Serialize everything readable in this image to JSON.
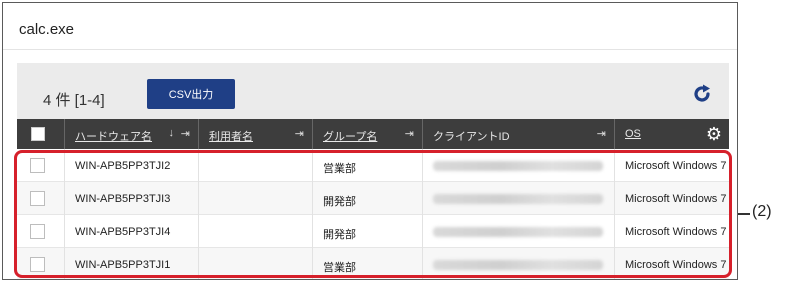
{
  "window": {
    "title": "calc.exe"
  },
  "toolbar": {
    "count_label": "4 件  [1-4]",
    "csv_button": "CSV出力",
    "refresh_icon": "refresh-icon"
  },
  "columns": [
    {
      "label": "ハードウェア名",
      "sortable": true,
      "sort": "↓"
    },
    {
      "label": "利用者名",
      "sortable": true
    },
    {
      "label": "グループ名",
      "sortable": true
    },
    {
      "label": "クライアントID",
      "sortable": false
    },
    {
      "label": "OS",
      "sortable": true
    }
  ],
  "rows": [
    {
      "hardware": "WIN-APB5PP3TJI2",
      "user": "",
      "group": "営業部",
      "os": "Microsoft Windows 7"
    },
    {
      "hardware": "WIN-APB5PP3TJI3",
      "user": "",
      "group": "開発部",
      "os": "Microsoft Windows 7"
    },
    {
      "hardware": "WIN-APB5PP3TJI4",
      "user": "",
      "group": "開発部",
      "os": "Microsoft Windows 7"
    },
    {
      "hardware": "WIN-APB5PP3TJI1",
      "user": "",
      "group": "営業部",
      "os": "Microsoft Windows 7"
    }
  ],
  "callout": {
    "label": "(2)",
    "highlight_color": "#d6202b"
  },
  "colors": {
    "header_bg": "#3d3d3d",
    "button_bg": "#1f3f86",
    "accent": "#1f3f86"
  }
}
